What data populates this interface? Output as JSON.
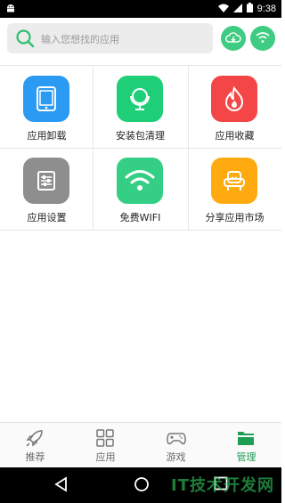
{
  "status_bar": {
    "time": "9:38",
    "notification_icon": "android-icon",
    "icons": [
      "wifi-icon",
      "signal-icon",
      "battery-icon"
    ]
  },
  "search": {
    "placeholder": "输入您想找的应用",
    "icon": "search-icon"
  },
  "header_buttons": [
    {
      "name": "cloud-download-icon"
    },
    {
      "name": "wifi-icon"
    }
  ],
  "grid": {
    "items": [
      {
        "label": "应用卸载",
        "icon": "tablet-icon",
        "color": "#2b9af3"
      },
      {
        "label": "安装包清理",
        "icon": "globe-icon",
        "color": "#1fcf77"
      },
      {
        "label": "应用收藏",
        "icon": "flame-icon",
        "color": "#f44646"
      },
      {
        "label": "应用设置",
        "icon": "settings-sliders-icon",
        "color": "#8e8e8e"
      },
      {
        "label": "免费WIFI",
        "icon": "wifi-icon",
        "color": "#34cf84"
      },
      {
        "label": "分享应用市场",
        "icon": "armchair-icon",
        "color": "#ffab0f"
      }
    ]
  },
  "bottom_nav": {
    "items": [
      {
        "label": "推荐",
        "icon": "rocket-icon",
        "active": false
      },
      {
        "label": "应用",
        "icon": "apps-grid-icon",
        "active": false
      },
      {
        "label": "游戏",
        "icon": "gamepad-icon",
        "active": false
      },
      {
        "label": "管理",
        "icon": "folder-icon",
        "active": true
      }
    ],
    "active_color": "#1f9d55"
  },
  "system_nav": {
    "watermark": "IT技术开发网"
  }
}
